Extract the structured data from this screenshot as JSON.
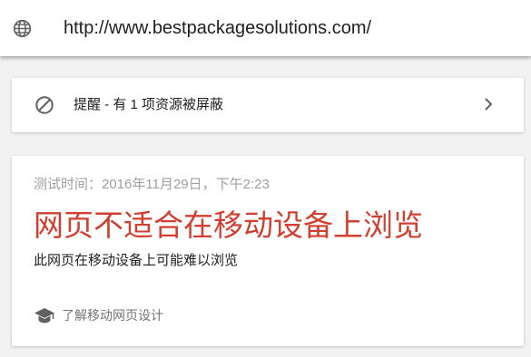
{
  "address_bar": {
    "url": "http://www.bestpackagesolutions.com/",
    "icon": "globe-icon"
  },
  "alert": {
    "text": "提醒 - 有 1 项资源被屏蔽",
    "icon": "block-icon",
    "action_icon": "chevron-right-icon"
  },
  "result": {
    "test_time": "测试时间：2016年11月29日，下午2:23",
    "verdict_title": "网页不适合在移动设备上浏览",
    "verdict_description": "此网页在移动设备上可能难以浏览",
    "learn_more_label": "了解移动网页设计",
    "learn_more_icon": "graduation-cap-icon",
    "verdict_color": "#d23f31"
  }
}
